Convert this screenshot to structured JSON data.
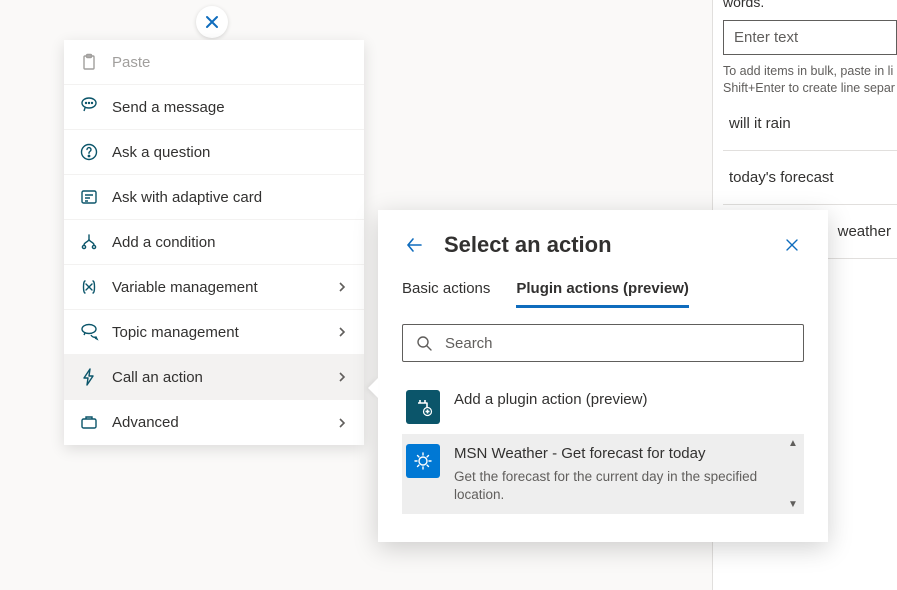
{
  "rightPanel": {
    "topline": "words.",
    "enterPlaceholder": "Enter text",
    "hint1": "To add items in bulk, paste in li",
    "hint2": "Shift+Enter to create line separ",
    "items": [
      "will it rain",
      "today's forecast",
      "weather"
    ]
  },
  "contextMenu": {
    "items": [
      {
        "label": "Paste",
        "icon": "paste-icon",
        "disabled": true,
        "hasSubmenu": false
      },
      {
        "label": "Send a message",
        "icon": "message-icon",
        "disabled": false,
        "hasSubmenu": false
      },
      {
        "label": "Ask a question",
        "icon": "question-icon",
        "disabled": false,
        "hasSubmenu": false
      },
      {
        "label": "Ask with adaptive card",
        "icon": "card-icon",
        "disabled": false,
        "hasSubmenu": false
      },
      {
        "label": "Add a condition",
        "icon": "condition-icon",
        "disabled": false,
        "hasSubmenu": false
      },
      {
        "label": "Variable management",
        "icon": "variable-icon",
        "disabled": false,
        "hasSubmenu": true
      },
      {
        "label": "Topic management",
        "icon": "topic-icon",
        "disabled": false,
        "hasSubmenu": true
      },
      {
        "label": "Call an action",
        "icon": "action-icon",
        "disabled": false,
        "hasSubmenu": true,
        "selected": true
      },
      {
        "label": "Advanced",
        "icon": "advanced-icon",
        "disabled": false,
        "hasSubmenu": true
      }
    ]
  },
  "actionPanel": {
    "title": "Select an action",
    "tabs": [
      {
        "label": "Basic actions",
        "active": false
      },
      {
        "label": "Plugin actions (preview)",
        "active": true
      }
    ],
    "searchPlaceholder": "Search",
    "actions": [
      {
        "title": "Add a plugin action (preview)",
        "desc": "",
        "iconClass": "teal",
        "iconName": "plugin-add-icon",
        "highlight": false
      },
      {
        "title": "MSN Weather - Get forecast for today",
        "desc": "Get the forecast for the current day in the specified location.",
        "iconClass": "blue",
        "iconName": "weather-icon",
        "highlight": true
      }
    ]
  }
}
